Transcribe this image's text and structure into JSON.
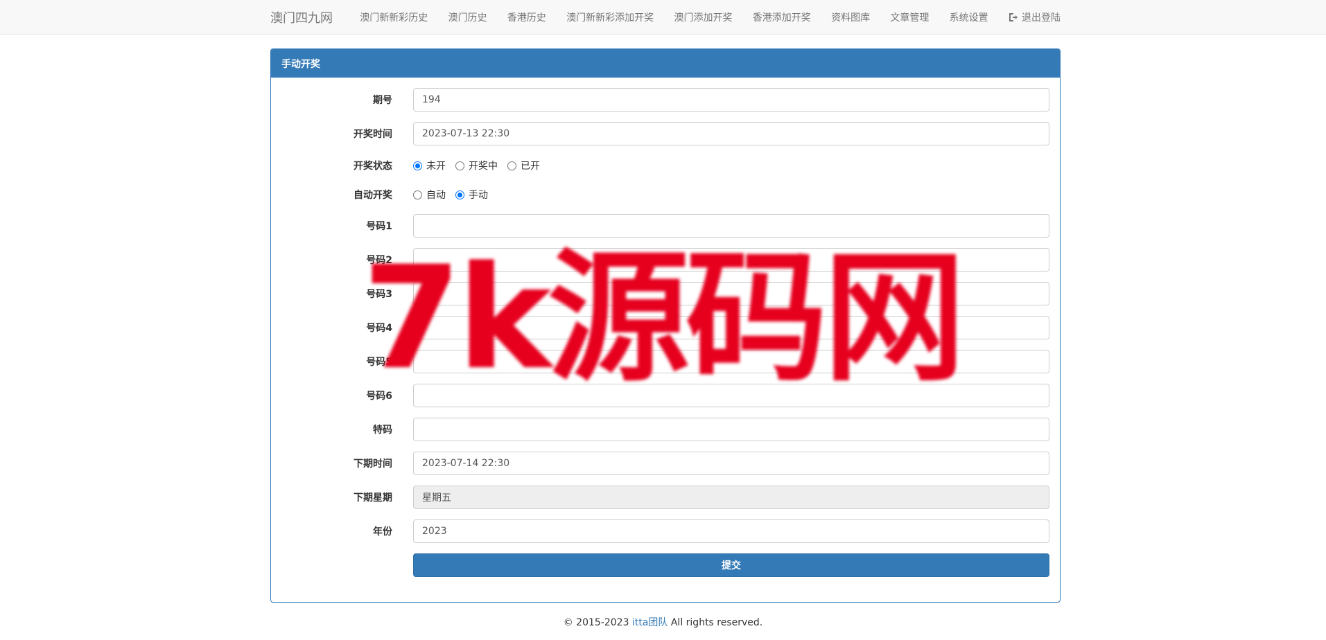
{
  "nav": {
    "brand": "澳门四九网",
    "links": [
      "澳门新新彩历史",
      "澳门历史",
      "香港历史",
      "澳门新新彩添加开奖",
      "澳门添加开奖",
      "香港添加开奖",
      "资料图库",
      "文章管理",
      "系统设置"
    ],
    "logout": "退出登陆"
  },
  "panel": {
    "title": "手动开奖"
  },
  "form": {
    "issue_label": "期号",
    "issue_value": "194",
    "draw_time_label": "开奖时间",
    "draw_time_value": "2023-07-13 22:30",
    "status_label": "开奖状态",
    "status_options": [
      "未开",
      "开奖中",
      "已开"
    ],
    "status_selected": "未开",
    "auto_label": "自动开奖",
    "auto_options": [
      "自动",
      "手动"
    ],
    "auto_selected": "手动",
    "num_labels": [
      "号码1",
      "号码2",
      "号码3",
      "号码4",
      "号码5",
      "号码6"
    ],
    "num_values": [
      "",
      "",
      "",
      "",
      "",
      ""
    ],
    "special_label": "特码",
    "special_value": "",
    "next_time_label": "下期时间",
    "next_time_value": "2023-07-14 22:30",
    "next_week_label": "下期星期",
    "next_week_value": "星期五",
    "year_label": "年份",
    "year_value": "2023",
    "submit_label": "提交"
  },
  "footer": {
    "prefix": "© 2015-2023 ",
    "team": "itta团队",
    "suffix": " All rights reserved."
  },
  "watermark": {
    "text": "7k源码网"
  },
  "colors": {
    "primary": "#337ab7",
    "radio_checked": "#0075ff",
    "watermark": "#e6001e"
  }
}
